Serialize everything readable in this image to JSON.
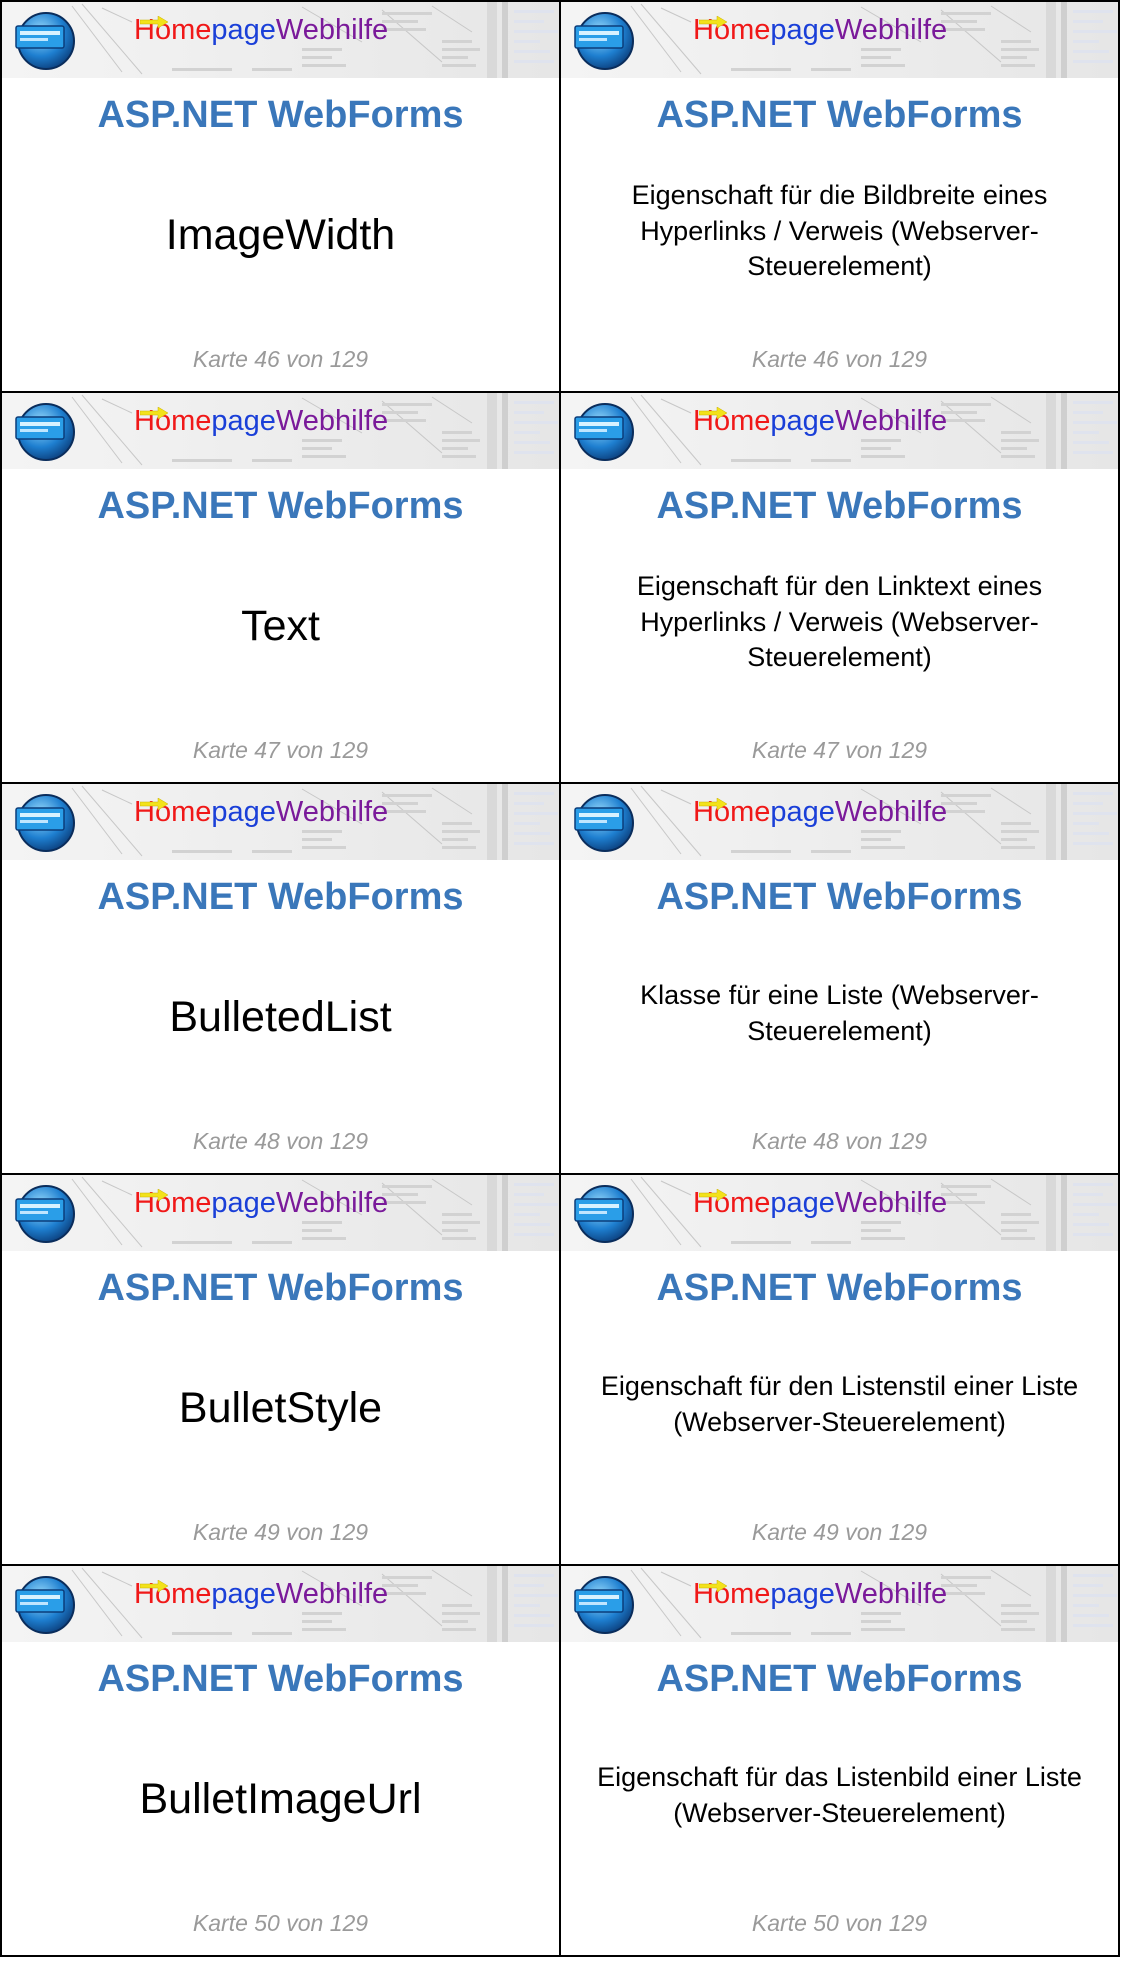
{
  "banner": {
    "home_prefix": "Home",
    "home_suffix": "page",
    "webhilfe": "Webhilfe"
  },
  "title": "ASP.NET WebForms",
  "cards": [
    {
      "front": "ImageWidth",
      "back": "Eigenschaft für die Bildbreite eines Hyperlinks / Verweis (Webserver-Steuerelement)",
      "label": "Karte 46 von 129"
    },
    {
      "front": "Text",
      "back": "Eigenschaft für den Linktext eines Hyperlinks / Verweis (Webserver-Steuerelement)",
      "label": "Karte 47 von 129"
    },
    {
      "front": "BulletedList",
      "back": "Klasse für eine Liste (Webserver-Steuerelement)",
      "label": "Karte 48 von 129"
    },
    {
      "front": "BulletStyle",
      "back": "Eigenschaft für den Listenstil einer Liste (Webserver-Steuerelement)",
      "label": "Karte 49 von 129"
    },
    {
      "front": "BulletImageUrl",
      "back": "Eigenschaft für das Listenbild einer Liste (Webserver-Steuerelement)",
      "label": "Karte 50 von 129"
    }
  ]
}
